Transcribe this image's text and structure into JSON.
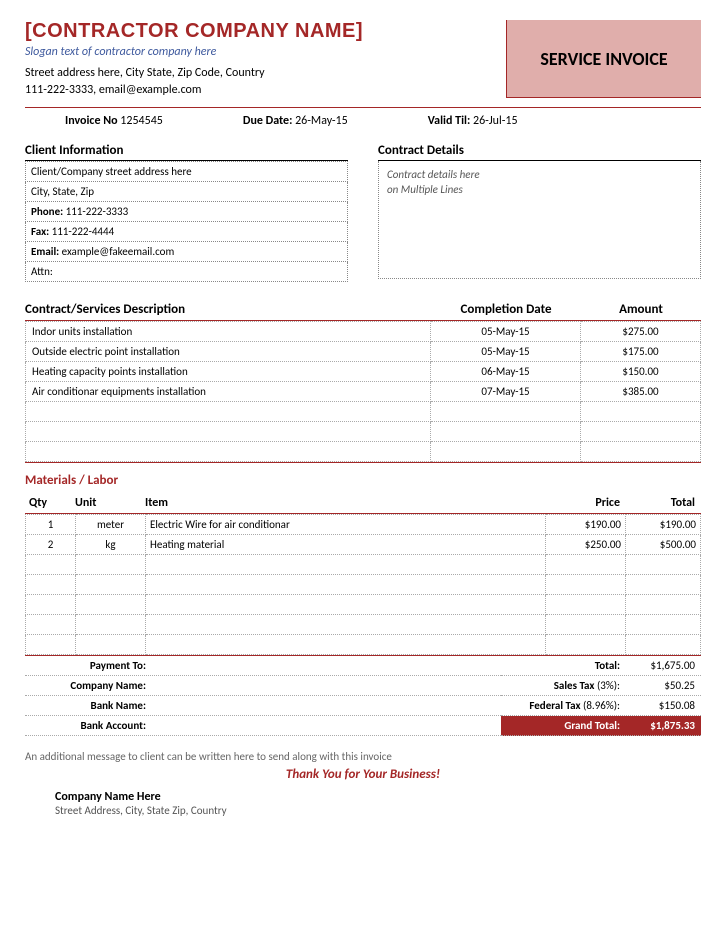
{
  "header": {
    "company_name": "[CONTRACTOR COMPANY NAME]",
    "slogan": "Slogan text of contractor company here",
    "address_line": "Street address here, City State, Zip Code, Country",
    "contact_line": "111-222-3333, email@example.com",
    "banner": "SERVICE INVOICE"
  },
  "meta": {
    "invoice_no_label": "Invoice No",
    "invoice_no": "1254545",
    "due_date_label": "Due Date:",
    "due_date": "26-May-15",
    "valid_til_label": "Valid Til:",
    "valid_til": "26-Jul-15"
  },
  "client": {
    "title": "Client Information",
    "rows": [
      "Client/Company street address here",
      "City, State, Zip",
      "Phone: 111-222-3333",
      "Fax: 111-222-4444",
      "Email: example@fakeemail.com",
      "Attn:"
    ]
  },
  "contract": {
    "title": "Contract Details",
    "body_line1": "Contract details here",
    "body_line2": "on Multiple Lines"
  },
  "services": {
    "h1": "Contract/Services Description",
    "h2": "Completion Date",
    "h3": "Amount",
    "rows": [
      {
        "desc": "Indor units installation",
        "date": "05-May-15",
        "amount": "$275.00"
      },
      {
        "desc": "Outside electric point installation",
        "date": "05-May-15",
        "amount": "$175.00"
      },
      {
        "desc": "Heating capacity points installation",
        "date": "06-May-15",
        "amount": "$150.00"
      },
      {
        "desc": "Air conditionar equipments installation",
        "date": "07-May-15",
        "amount": "$385.00"
      }
    ],
    "empty_rows": 3
  },
  "materials": {
    "title": "Materials / Labor",
    "h_qty": "Qty",
    "h_unit": "Unit",
    "h_item": "Item",
    "h_price": "Price",
    "h_total": "Total",
    "rows": [
      {
        "qty": "1",
        "unit": "meter",
        "item": "Electric Wire for air conditionar",
        "price": "$190.00",
        "total": "$190.00"
      },
      {
        "qty": "2",
        "unit": "kg",
        "item": "Heating material",
        "price": "$250.00",
        "total": "$500.00"
      }
    ],
    "empty_rows": 5
  },
  "payment": {
    "l1": "Payment To:",
    "l2": "Company Name:",
    "l3": "Bank Name:",
    "l4": "Bank Account:"
  },
  "totals": {
    "total_lbl": "Total:",
    "total_val": "$1,675.00",
    "sales_lbl": "Sales Tax ",
    "sales_pct": "(3%):",
    "sales_val": "$50.25",
    "fed_lbl": "Federal Tax ",
    "fed_pct": "(8.96%):",
    "fed_val": "$150.08",
    "grand_lbl": "Grand Total:",
    "grand_val": "$1,875.33"
  },
  "footer": {
    "message": "An additional message to client can be written here to send along with this invoice",
    "thanks": "Thank You for Your Business!",
    "company": "Company Name Here",
    "address": "Street Address, City, State Zip, Country"
  }
}
